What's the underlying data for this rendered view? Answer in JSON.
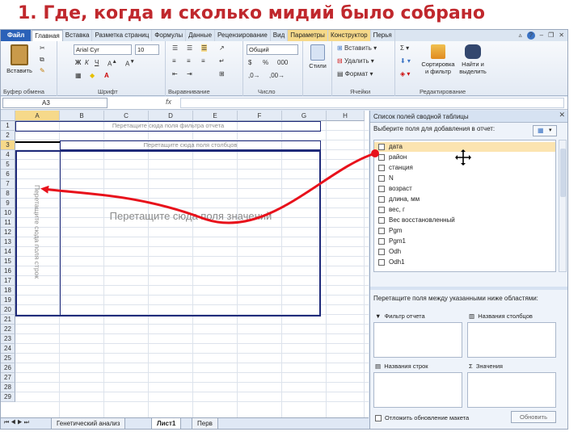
{
  "slide": {
    "title": "1. Где, когда и сколько мидий было собрано",
    "accent_color": "#c0282d",
    "arrow_color": "#e8111b"
  },
  "ribbon_tabs": [
    {
      "label": "Файл",
      "style": "file"
    },
    {
      "label": "Главная",
      "style": "active"
    },
    {
      "label": "Вставка",
      "style": ""
    },
    {
      "label": "Разметка страниц",
      "style": ""
    },
    {
      "label": "Формулы",
      "style": ""
    },
    {
      "label": "Данные",
      "style": ""
    },
    {
      "label": "Рецензирование",
      "style": ""
    },
    {
      "label": "Вид",
      "style": ""
    },
    {
      "label": "Параметры",
      "style": "hl"
    },
    {
      "label": "Конструктор",
      "style": "hl"
    },
    {
      "label": "Перья",
      "style": ""
    }
  ],
  "ribbon": {
    "clipboard": {
      "label": "Буфер обмена",
      "paste": "Вставить"
    },
    "font": {
      "label": "Шрифт",
      "font_name": "Arial Cyr",
      "font_size": "10"
    },
    "alignment": {
      "label": "Выравнивание"
    },
    "number": {
      "label": "Число",
      "format": "Общий"
    },
    "styles": {
      "label": "",
      "button": "Стили"
    },
    "cells": {
      "label": "Ячейки",
      "insert": "Вставить",
      "delete": "Удалить",
      "format": "Формат"
    },
    "editing": {
      "label": "Редактирование",
      "sort": "Сортировка и фильтр",
      "find": "Найти и выделить"
    }
  },
  "formula_bar": {
    "cell_ref": "A3",
    "fx": "fx",
    "value": ""
  },
  "grid": {
    "columns": [
      "A",
      "B",
      "C",
      "D",
      "E",
      "F",
      "G",
      "H"
    ],
    "rows": [
      "1",
      "2",
      "3",
      "4",
      "5",
      "6",
      "7",
      "8",
      "9",
      "10",
      "11",
      "12",
      "13",
      "14",
      "15",
      "16",
      "17",
      "18",
      "19",
      "20",
      "21",
      "22",
      "23",
      "24",
      "25",
      "26",
      "27",
      "28",
      "29"
    ],
    "pivot_report_filter": "Перетащите сюда поля фильтра отчета",
    "pivot_column_fields": "Перетащите сюда поля столбцов",
    "pivot_values": "Перетащите сюда поля значений",
    "pivot_row_fields": "Перетащите сюда поля строк"
  },
  "sheet_tabs": [
    {
      "label": "Генетический анализ",
      "active": false
    },
    {
      "label": "Лист1",
      "active": true
    },
    {
      "label": "Перв",
      "active": false
    }
  ],
  "pivot_panel": {
    "title": "Список полей сводной таблицы",
    "subtitle": "Выберите поля для добавления в отчет:",
    "fields": [
      {
        "label": "дата",
        "selected": true
      },
      {
        "label": "район",
        "selected": false
      },
      {
        "label": "станция",
        "selected": false
      },
      {
        "label": "N",
        "selected": false
      },
      {
        "label": "возраст",
        "selected": false
      },
      {
        "label": "длина, мм",
        "selected": false
      },
      {
        "label": "вес, г",
        "selected": false
      },
      {
        "label": "Вес восстановленный",
        "selected": false
      },
      {
        "label": "Pgm",
        "selected": false
      },
      {
        "label": "Pgm1",
        "selected": false
      },
      {
        "label": "Odh",
        "selected": false
      },
      {
        "label": "Odh1",
        "selected": false
      }
    ],
    "areas_hint": "Перетащите поля между указанными ниже областями:",
    "area_report_filter": "Фильтр отчета",
    "area_column_names": "Названия столбцов",
    "area_row_names": "Названия строк",
    "area_values": "Значения",
    "defer_label": "Отложить обновление макета",
    "update_button": "Обновить"
  }
}
